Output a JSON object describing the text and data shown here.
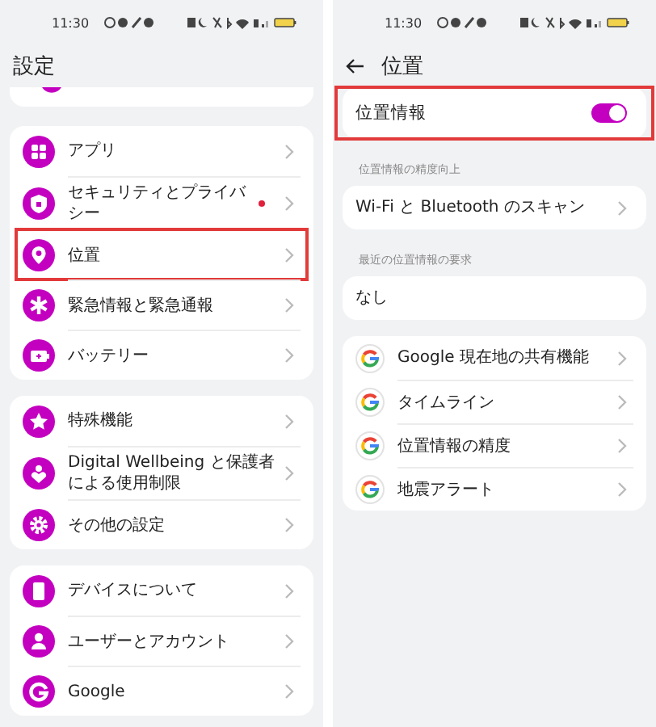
{
  "settings_screen": {
    "status_bar": {
      "time": "11:30"
    },
    "title": "設定",
    "groups": [
      {
        "items": [
          {
            "label": "アプリ",
            "highlighted": false,
            "notification_dot": false
          },
          {
            "label": "セキュリティとプライバシー",
            "highlighted": false,
            "notification_dot": true
          },
          {
            "label": "位置",
            "highlighted": true,
            "notification_dot": false
          },
          {
            "label": "緊急情報と緊急通報",
            "highlighted": false,
            "notification_dot": false
          },
          {
            "label": "バッテリー",
            "highlighted": false,
            "notification_dot": false
          }
        ]
      },
      {
        "items": [
          {
            "label": "特殊機能",
            "highlighted": false,
            "notification_dot": false
          },
          {
            "label": "Digital Wellbeing と保護者による使用制限",
            "highlighted": false,
            "notification_dot": false
          },
          {
            "label": "その他の設定",
            "highlighted": false,
            "notification_dot": false
          }
        ]
      },
      {
        "items": [
          {
            "label": "デバイスについて",
            "highlighted": false,
            "notification_dot": false
          },
          {
            "label": "ユーザーとアカウント",
            "highlighted": false,
            "notification_dot": false
          },
          {
            "label": "Google",
            "highlighted": false,
            "notification_dot": false
          }
        ]
      }
    ]
  },
  "location_screen": {
    "status_bar": {
      "time": "11:30"
    },
    "title": "位置",
    "location_toggle": {
      "label": "位置情報",
      "on": true,
      "highlighted": true
    },
    "sections": [
      {
        "header": "位置情報の精度向上",
        "items": [
          {
            "label": "Wi-Fi と Bluetooth のスキャン",
            "kind": "link"
          }
        ]
      },
      {
        "header": "最近の位置情報の要求",
        "items": [
          {
            "label": "なし",
            "kind": "static"
          }
        ]
      }
    ],
    "google_items": [
      {
        "label": "Google 現在地の共有機能"
      },
      {
        "label": "タイムライン"
      },
      {
        "label": "位置情報の精度"
      },
      {
        "label": "地震アラート"
      }
    ]
  }
}
